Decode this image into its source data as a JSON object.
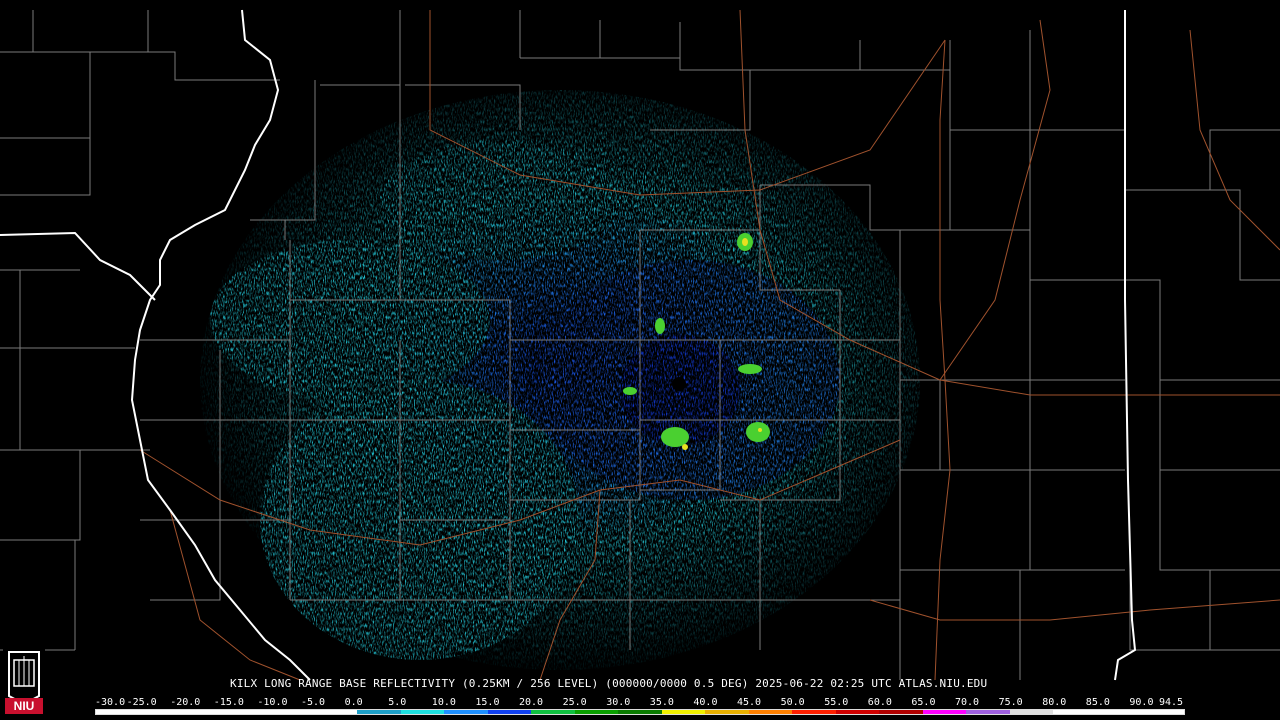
{
  "caption": "KILX LONG RANGE BASE REFLECTIVITY (0.25KM / 256 LEVEL) (000000/0000 0.5 DEG) 2025-06-22 02:25 UTC  ATLAS.NIU.EDU",
  "scale": {
    "labels": [
      "-30.0",
      "-25.0",
      "-20.0",
      "-15.0",
      "-10.0",
      "-5.0",
      "0.0",
      "5.0",
      "10.0",
      "15.0",
      "20.0",
      "25.0",
      "30.0",
      "35.0",
      "40.0",
      "45.0",
      "50.0",
      "55.0",
      "60.0",
      "65.0",
      "70.0",
      "75.0",
      "80.0",
      "85.0",
      "90.0",
      "94.5"
    ],
    "colors": [
      "#ffffff",
      "#ffffff",
      "#ffffff",
      "#ffffff",
      "#ffffff",
      "#ffffff",
      "#1ea0c8",
      "#1ee0e0",
      "#1e90ff",
      "#1040f0",
      "#10c040",
      "#0aa000",
      "#0a7a00",
      "#f0f000",
      "#e8b000",
      "#ff8000",
      "#ff2000",
      "#d00000",
      "#b00000",
      "#ff00ff",
      "#a060e0",
      "#e0e0e0",
      "#ffffff",
      "#ffffff",
      "#ffffff"
    ]
  },
  "logo": {
    "text": "NIU",
    "bg": "#c8102e"
  },
  "radar": {
    "site_color": "#000000"
  },
  "colors": {
    "background": "#000000",
    "county_lines": "#7a7a7a",
    "state_lines": "#ffffff",
    "roads": "#a0522d",
    "echo_light": "#23c8d8",
    "echo_mid": "#1e78f0",
    "echo_dark": "#1030d0",
    "echo_green": "#4ad030",
    "echo_yellow": "#e8e020"
  }
}
